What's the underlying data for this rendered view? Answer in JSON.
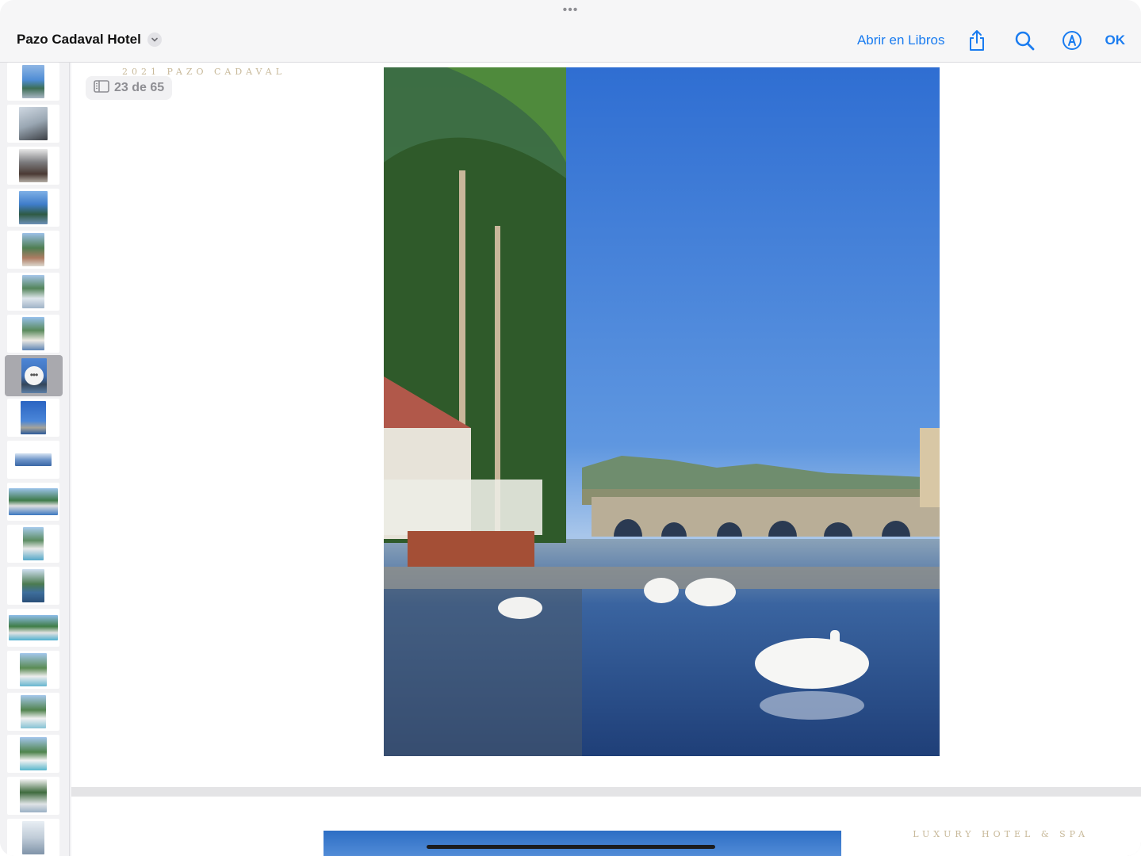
{
  "topbar": {
    "grabber": "•••",
    "title": "Pazo Cadaval Hotel",
    "open_in_books": "Abrir en Libros",
    "ok": "OK",
    "icons": [
      "chevron-down-icon",
      "share-icon",
      "search-icon",
      "markup-icon"
    ],
    "accent_color": "#1a7cf0"
  },
  "page": {
    "header_text": "2021 PAZO CADAVAL",
    "counter": "23 de 65",
    "next_page_tag": "LUXURY HOTEL & SPA"
  },
  "sidebar": {
    "selected_index": 7,
    "thumbnail_count": 19
  }
}
